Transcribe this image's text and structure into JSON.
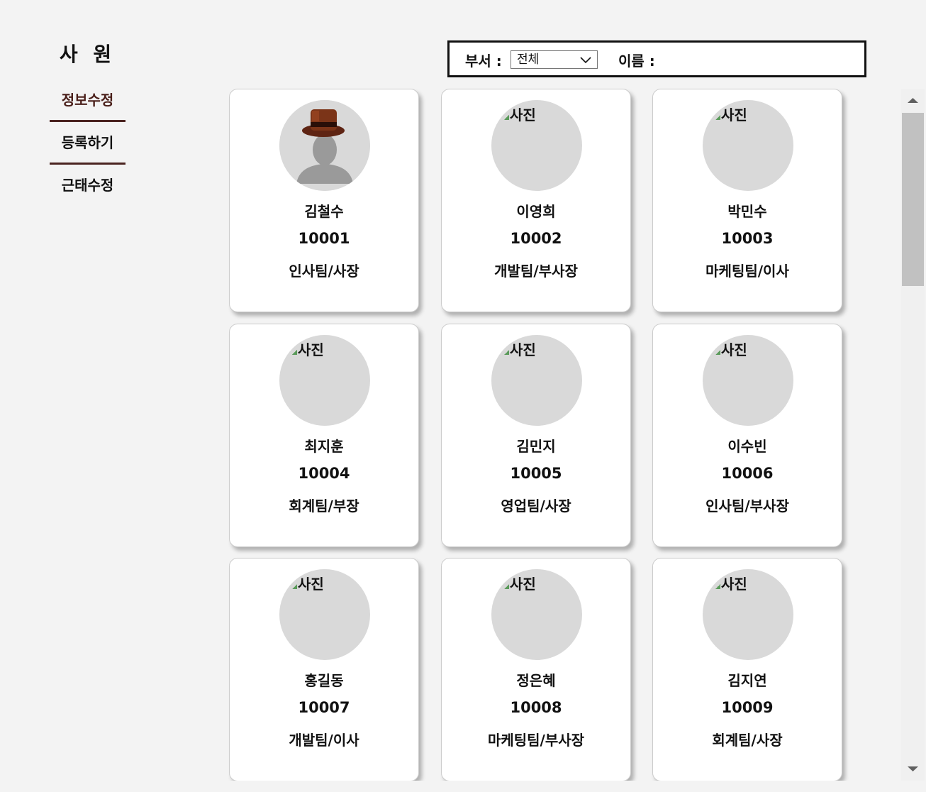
{
  "sidebar": {
    "title": "사 원",
    "items": [
      {
        "label": "정보수정"
      },
      {
        "label": "등록하기"
      },
      {
        "label": "근태수정"
      }
    ]
  },
  "filter": {
    "dept_label": "부서 :",
    "dept_selected": "전체",
    "name_label": "이름 :",
    "name_value": ""
  },
  "cards": [
    {
      "name": "김철수",
      "id": "10001",
      "role": "인사팀/사장",
      "photo_alt": "",
      "has_avatar": true
    },
    {
      "name": "이영희",
      "id": "10002",
      "role": "개발팀/부사장",
      "photo_alt": "사진"
    },
    {
      "name": "박민수",
      "id": "10003",
      "role": "마케팅팀/이사",
      "photo_alt": "사진"
    },
    {
      "name": "최지훈",
      "id": "10004",
      "role": "회계팀/부장",
      "photo_alt": "사진"
    },
    {
      "name": "김민지",
      "id": "10005",
      "role": "영업팀/사장",
      "photo_alt": "사진"
    },
    {
      "name": "이수빈",
      "id": "10006",
      "role": "인사팀/부사장",
      "photo_alt": "사진"
    },
    {
      "name": "홍길동",
      "id": "10007",
      "role": "개발팀/이사",
      "photo_alt": "사진"
    },
    {
      "name": "정은혜",
      "id": "10008",
      "role": "마케팅팀/부사장",
      "photo_alt": "사진"
    },
    {
      "name": "김지연",
      "id": "10009",
      "role": "회계팀/사장",
      "photo_alt": "사진"
    }
  ],
  "colors": {
    "accent": "#4a2320",
    "card_border": "#cccccc",
    "photo_bg": "#d9d9d9"
  }
}
